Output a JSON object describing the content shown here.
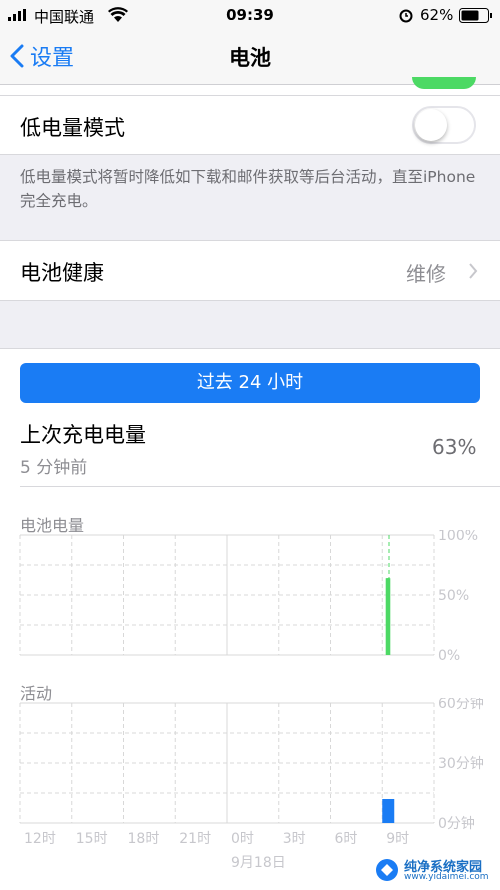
{
  "status_bar": {
    "carrier": "中国联通",
    "time": "09:39",
    "battery": "62%"
  },
  "nav": {
    "back_label": "设置",
    "title": "电池"
  },
  "low_power": {
    "label": "低电量模式",
    "enabled": false,
    "footer": "低电量模式将暂时降低如下载和邮件获取等后台活动，直至iPhone 完全充电。"
  },
  "battery_health": {
    "label": "电池健康",
    "value": "维修"
  },
  "segment": {
    "label": "过去 24 小时"
  },
  "last_charge": {
    "label": "上次充电电量",
    "time": "5 分钟前",
    "value": "63%"
  },
  "colors": {
    "accent": "#1a7cf4",
    "battery_green": "#4cd964",
    "activity_blue": "#1a7cf4"
  },
  "chart_data": [
    {
      "type": "bar",
      "title": "电池电量",
      "x_ticks": [
        "12时",
        "15时",
        "18时",
        "21时",
        "0时",
        "3时",
        "6时",
        "9时"
      ],
      "y_ticks": [
        "100%",
        "50%",
        "0%"
      ],
      "ylim": [
        0,
        100
      ],
      "series": [
        {
          "values": [
            {
              "x": "09:12",
              "y": 64
            },
            {
              "x": "09:15",
              "y": 64
            },
            {
              "x": "09:18",
              "y": 64
            },
            {
              "x": "09:21",
              "y": 64
            }
          ]
        }
      ],
      "grid": true
    },
    {
      "type": "bar",
      "title": "活动",
      "x_ticks": [
        "12时",
        "15时",
        "18时",
        "21时",
        "0时",
        "3时",
        "6时",
        "9时"
      ],
      "date_label": "9月18日",
      "y_ticks": [
        "60分钟",
        "30分钟",
        "0分钟"
      ],
      "ylim": [
        0,
        60
      ],
      "series": [
        {
          "values": [
            {
              "x": "09:00",
              "y": 12
            }
          ]
        }
      ],
      "grid": true
    }
  ]
}
